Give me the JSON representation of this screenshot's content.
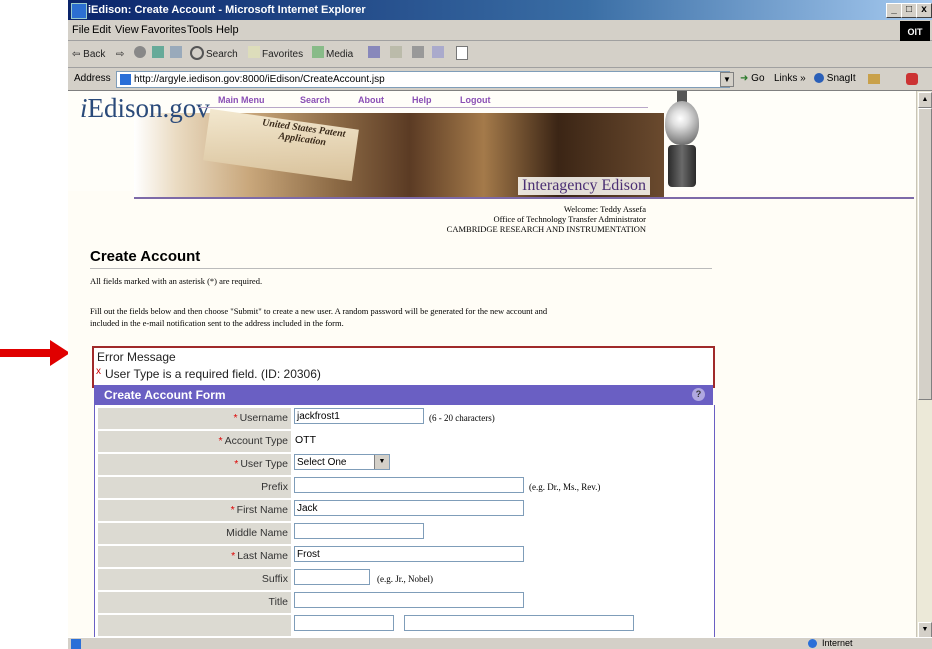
{
  "window": {
    "title": "iEdison: Create Account - Microsoft Internet Explorer",
    "min": "_",
    "max": "□",
    "close": "x",
    "oit": "OIT"
  },
  "menus": [
    "File",
    "Edit",
    "View",
    "Favorites",
    "Tools",
    "Help"
  ],
  "toolbar": {
    "back": "⇦ Back",
    "forward": "⇨",
    "search": "Search",
    "favorites": "Favorites",
    "media": "Media"
  },
  "address": {
    "label": "Address",
    "url": "http://argyle.iedison.gov:8000/iEdison/CreateAccount.jsp",
    "go": "Go",
    "links": "Links",
    "snagit": "SnagIt"
  },
  "banner": {
    "brand_prefix": "i",
    "brand_rest": "Edison.gov",
    "nav": [
      "Main Menu",
      "Search",
      "About",
      "Help",
      "Logout"
    ],
    "paper_text": "United States Patent Application",
    "tagline": "Interagency Edison"
  },
  "welcome": {
    "line1": "Welcome: Teddy Assefa",
    "line2": "Office of Technology Transfer Administrator",
    "line3": "CAMBRIDGE RESEARCH AND INSTRUMENTATION"
  },
  "page": {
    "heading": "Create Account",
    "required_note": "All fields marked with an asterisk (*) are required.",
    "instructions_1": "Fill out the fields below and then choose \"Submit\" to create a new user. A random password will be generated for the new account and",
    "instructions_2": "included in the e-mail notification sent to the address included in the form."
  },
  "error": {
    "title": "Error Message",
    "icon": "x",
    "message": "User Type is a required field. (ID: 20306)"
  },
  "form": {
    "title": "Create Account Form",
    "help_icon": "?",
    "asterisk": "*",
    "username_label": "Username",
    "username_value": "jackfrost1",
    "username_hint": "(6 - 20 characters)",
    "account_type_label": "Account Type",
    "account_type_value": "OTT",
    "user_type_label": "User Type",
    "user_type_selected": "Select One",
    "prefix_label": "Prefix",
    "prefix_value": "",
    "prefix_hint": "(e.g. Dr., Ms., Rev.)",
    "first_name_label": "First Name",
    "first_name_value": "Jack",
    "middle_name_label": "Middle Name",
    "middle_name_value": "",
    "last_name_label": "Last Name",
    "last_name_value": "Frost",
    "suffix_label": "Suffix",
    "suffix_value": "",
    "suffix_hint": "(e.g. Jr., Nobel)",
    "title_label": "Title",
    "title_value": ""
  },
  "status": {
    "zone": "Internet"
  },
  "colors": {
    "form_header": "#6a5fc3",
    "error_border": "#a02a2a",
    "arrow": "#e00000"
  }
}
